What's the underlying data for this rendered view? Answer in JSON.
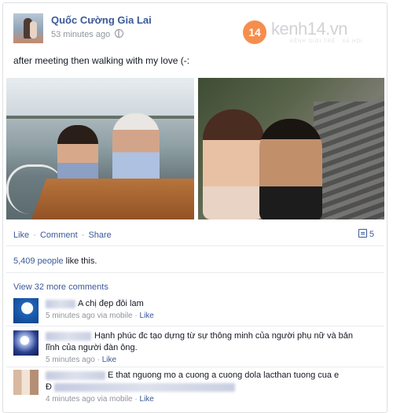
{
  "post": {
    "author": "Quốc Cường Gia Lai",
    "time": "53 minutes ago",
    "text": "after meeting then walking with my love (-:",
    "watermark": {
      "badge": "14",
      "brand": "kenh14.vn",
      "tagline": "KÊNH GIỚI TRẺ · XÃ HỘI"
    }
  },
  "actions": {
    "like": "Like",
    "comment": "Comment",
    "share": "Share",
    "comment_count": "5"
  },
  "likes": {
    "count": "5,409 people",
    "suffix": " like this."
  },
  "view_more": "View 32 more comments",
  "comments": [
    {
      "text": "A chị đẹp đôi lam",
      "meta": "5 minutes ago via mobile",
      "like": "Like"
    },
    {
      "text": "Hạnh phúc đc tạo dựng từ sự thông minh của người phụ nữ và bản lĩnh của người đàn ông.",
      "meta": "5 minutes ago",
      "like": "Like"
    },
    {
      "text": "E that nguong mo a cuong a cuong dola lacthan tuong cua e",
      "line2": "Đ",
      "meta": "4 minutes ago via mobile",
      "like": "Like"
    }
  ],
  "colors": {
    "link": "#3b5998",
    "meta": "#90949c",
    "text": "#141823",
    "border": "#dddfe2"
  }
}
